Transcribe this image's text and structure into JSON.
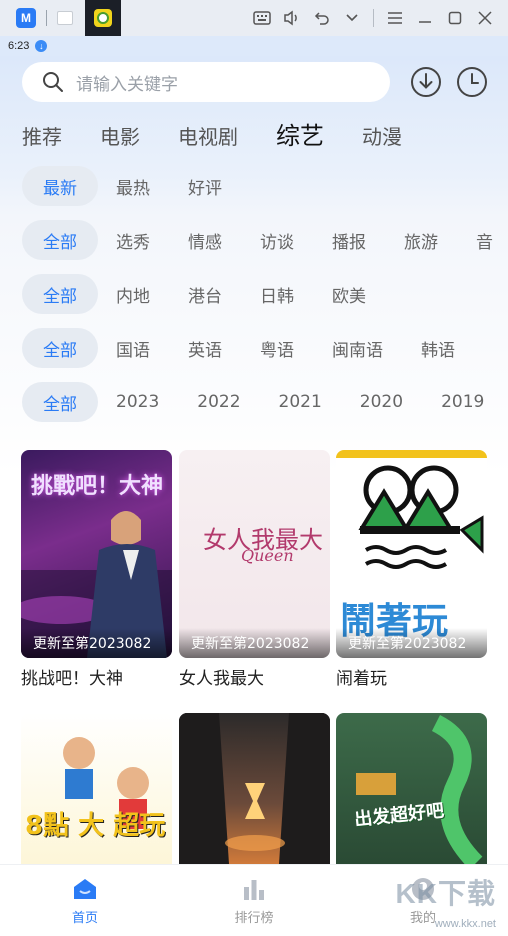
{
  "status": {
    "time": "6:23"
  },
  "search": {
    "placeholder": "请输入关键字"
  },
  "categories": [
    "推荐",
    "电影",
    "电视剧",
    "综艺",
    "动漫"
  ],
  "filters": {
    "sort": [
      "最新",
      "最热",
      "好评"
    ],
    "type": [
      "全部",
      "选秀",
      "情感",
      "访谈",
      "播报",
      "旅游",
      "音"
    ],
    "region": [
      "全部",
      "内地",
      "港台",
      "日韩",
      "欧美"
    ],
    "language": [
      "全部",
      "国语",
      "英语",
      "粤语",
      "闽南语",
      "韩语"
    ],
    "year": [
      "全部",
      "2023",
      "2022",
      "2021",
      "2020",
      "2019"
    ]
  },
  "cards": [
    {
      "title": "挑战吧！大神",
      "badge": "更新至第2023082"
    },
    {
      "title": "女人我最大",
      "badge": "更新至第2023082"
    },
    {
      "title": "闹着玩",
      "badge": "更新至第2023082"
    },
    {
      "title": "",
      "badge": ""
    },
    {
      "title": "",
      "badge": ""
    },
    {
      "title": "",
      "badge": ""
    }
  ],
  "poster_text": {
    "p1": "挑戰吧！大神",
    "p2": "女人我最大",
    "p2b": "Queen",
    "p3": "鬧著玩",
    "p4": "8點 大 超玩",
    "p6": "出发超好吧"
  },
  "nav": [
    {
      "label": "首页"
    },
    {
      "label": "排行榜"
    },
    {
      "label": "我的"
    }
  ],
  "watermark": {
    "brand": "KK下载",
    "url": "www.kkx.net"
  },
  "colors": {
    "accent": "#2a7bf5",
    "chip_bg": "#e6ebf2"
  }
}
